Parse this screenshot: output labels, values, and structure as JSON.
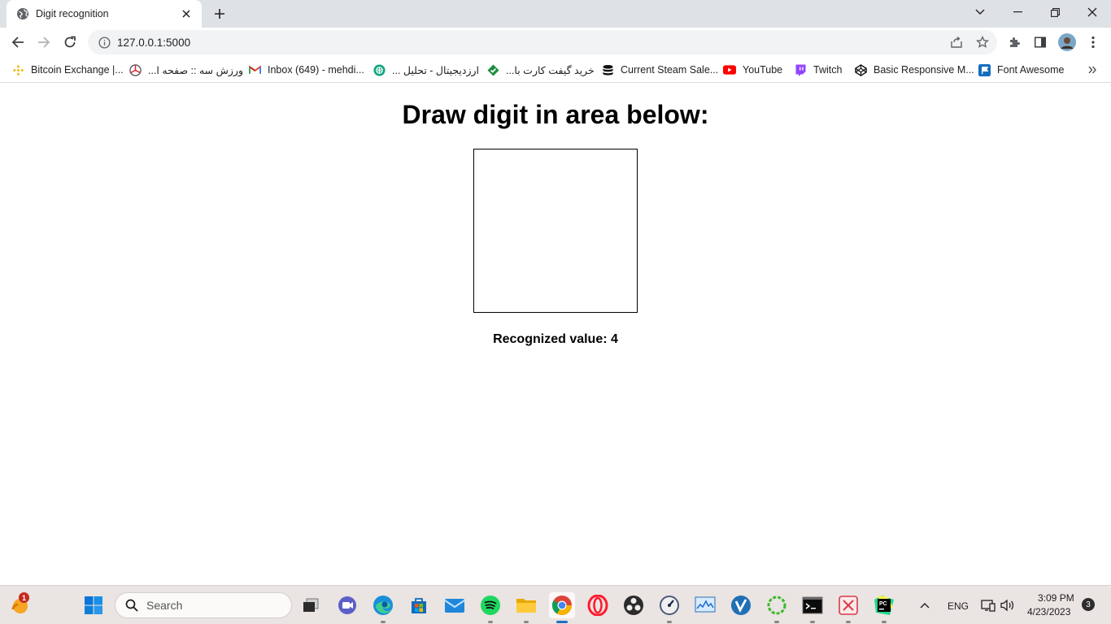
{
  "browser": {
    "tab_title": "Digit recognition",
    "url": "127.0.0.1:5000"
  },
  "bookmarks": [
    {
      "label": "Bitcoin Exchange |...",
      "icon": "binance-icon"
    },
    {
      "label": "ورزش سه :: صفحه ا...",
      "icon": "varzesh3-icon"
    },
    {
      "label": "Inbox (649) - mehdi...",
      "icon": "gmail-icon"
    },
    {
      "label": "ارزدیجیتال - تحلیل ...",
      "icon": "chatgpt-icon"
    },
    {
      "label": "خرید گیفت کارت با...",
      "icon": "giftcard-icon"
    },
    {
      "label": "Current Steam Sale...",
      "icon": "steamdb-icon"
    },
    {
      "label": "YouTube",
      "icon": "youtube-icon"
    },
    {
      "label": "Twitch",
      "icon": "twitch-icon"
    },
    {
      "label": "Basic Responsive M...",
      "icon": "codepen-icon"
    },
    {
      "label": "Font Awesome",
      "icon": "fontawesome-icon"
    }
  ],
  "page": {
    "heading": "Draw digit in area below:",
    "result_label": "Recognized value: 4"
  },
  "taskbar": {
    "search_placeholder": "Search",
    "weather_badge": "1",
    "language": "ENG",
    "time": "3:09 PM",
    "date": "4/23/2023",
    "notification_count": "3"
  },
  "colors": {
    "tabstrip_bg": "#dee1e6",
    "omnibox_bg": "#f1f3f4",
    "taskbar_bg": "#eae4e2",
    "youtube_red": "#ff0000",
    "twitch_purple": "#9146ff"
  }
}
